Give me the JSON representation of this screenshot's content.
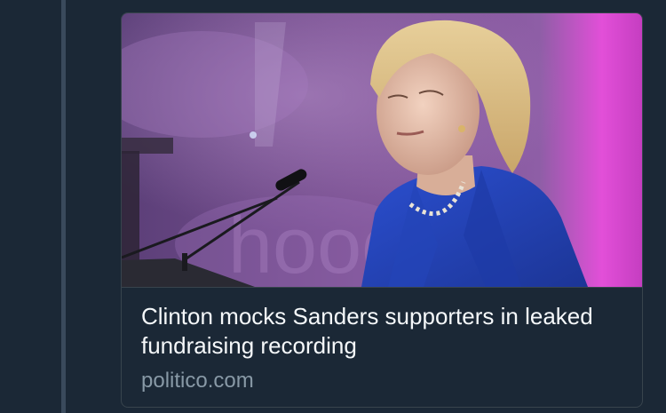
{
  "card": {
    "title": "Clinton mocks Sanders supporters in leaked fundraising recording",
    "domain": "politico.com",
    "image_icon": "photo-of-speaker-at-podium"
  },
  "colors": {
    "background": "#1b2836",
    "thread_line": "#3a4a5c",
    "card_border": "#38444d",
    "title_text": "#f5f8fa",
    "domain_text": "#8899a6"
  }
}
